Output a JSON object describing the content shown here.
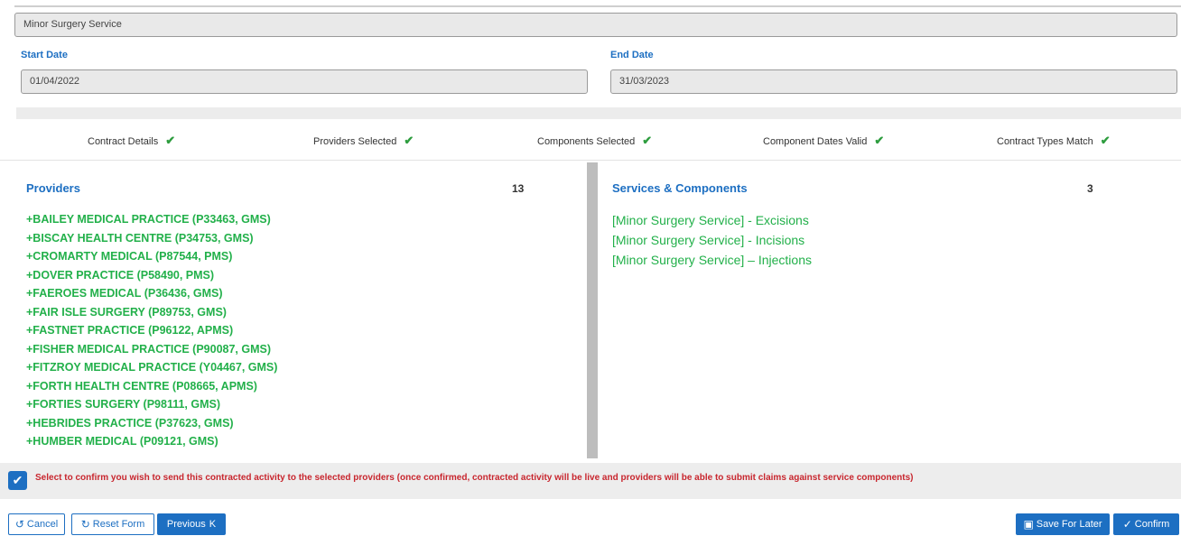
{
  "service_name": "Minor Surgery Service",
  "start_date": {
    "label": "Start Date",
    "value": "01/04/2022"
  },
  "end_date": {
    "label": "End Date",
    "value": "31/03/2023"
  },
  "steps": [
    {
      "label": "Contract Details",
      "status": "✔"
    },
    {
      "label": "Providers Selected",
      "status": "✔"
    },
    {
      "label": "Components Selected",
      "status": "✔"
    },
    {
      "label": "Component Dates Valid",
      "status": "✔"
    },
    {
      "label": "Contract Types Match",
      "status": "✔"
    }
  ],
  "providers": {
    "title": "Providers",
    "count": "13",
    "items": [
      "+BAILEY MEDICAL PRACTICE (P33463, GMS)",
      "+BISCAY HEALTH CENTRE (P34753, GMS)",
      "+CROMARTY MEDICAL (P87544, PMS)",
      "+DOVER PRACTICE (P58490, PMS)",
      "+FAEROES MEDICAL (P36436, GMS)",
      "+FAIR ISLE SURGERY (P89753, GMS)",
      "+FASTNET PRACTICE (P96122, APMS)",
      "+FISHER MEDICAL PRACTICE (P90087, GMS)",
      "+FITZROY MEDICAL PRACTICE (Y04467, GMS)",
      "+FORTH HEALTH CENTRE (P08665, APMS)",
      "+FORTIES SURGERY (P98111, GMS)",
      "+HEBRIDES PRACTICE (P37623, GMS)",
      "+HUMBER MEDICAL (P09121, GMS)"
    ]
  },
  "services": {
    "title": "Services & Components",
    "count": "3",
    "items": [
      "[Minor Surgery Service] - Excisions",
      "[Minor Surgery Service] - Incisions",
      "[Minor Surgery Service] – Injections"
    ]
  },
  "confirmation": {
    "checked": true,
    "check_glyph": "✔",
    "text": "Select to confirm you wish to send this contracted activity to the selected providers (once confirmed, contracted activity will be live and providers will be able to submit claims against service components)"
  },
  "buttons": {
    "cancel": {
      "icon": "undo-icon",
      "glyph": "↺",
      "label": "Cancel"
    },
    "reset": {
      "icon": "redo-icon",
      "glyph": "↻",
      "label": "Reset Form"
    },
    "previous": {
      "icon": "step-back-icon",
      "glyph": "K",
      "label": "Previous"
    },
    "save": {
      "icon": "save-icon",
      "glyph": "▣",
      "label": "Save For Later"
    },
    "confirm": {
      "icon": "check-icon",
      "glyph": "✓",
      "label": "Confirm"
    }
  },
  "colors": {
    "accent": "#1d6fc2",
    "success": "#22b04a",
    "danger": "#c8262e"
  }
}
